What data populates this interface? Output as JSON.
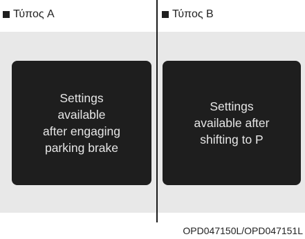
{
  "panels": [
    {
      "type_label": "Τύπος A",
      "message": "Settings\navailable\nafter engaging\nparking brake"
    },
    {
      "type_label": "Τύπος B",
      "message": "Settings\navailable after\nshifting to P"
    }
  ],
  "figure_code": "OPD047150L/OPD047151L"
}
